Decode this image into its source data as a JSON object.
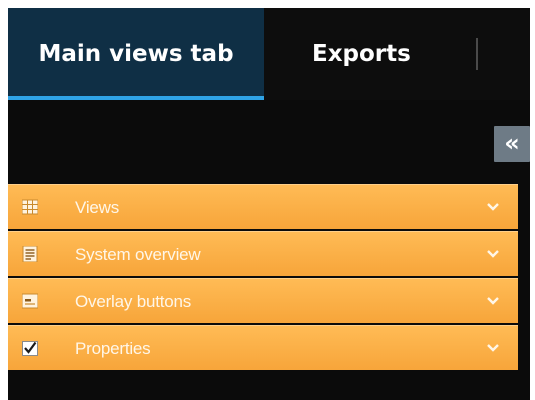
{
  "tabs": {
    "main_label": "Main views tab",
    "exports_label": "Exports"
  },
  "collapse_button": {
    "glyph": "«",
    "icon": "double-chevron-left-icon"
  },
  "panels": [
    {
      "label": "Views",
      "icon": "grid-icon"
    },
    {
      "label": "System overview",
      "icon": "document-list-icon"
    },
    {
      "label": "Overlay buttons",
      "icon": "overlay-button-icon"
    },
    {
      "label": "Properties",
      "icon": "checkbox-icon"
    }
  ],
  "colors": {
    "active_tab": "#0f2f45",
    "active_tab_underline": "#2fa3e6",
    "panel_orange": "#f7a53a",
    "background": "#0b0b0b"
  }
}
